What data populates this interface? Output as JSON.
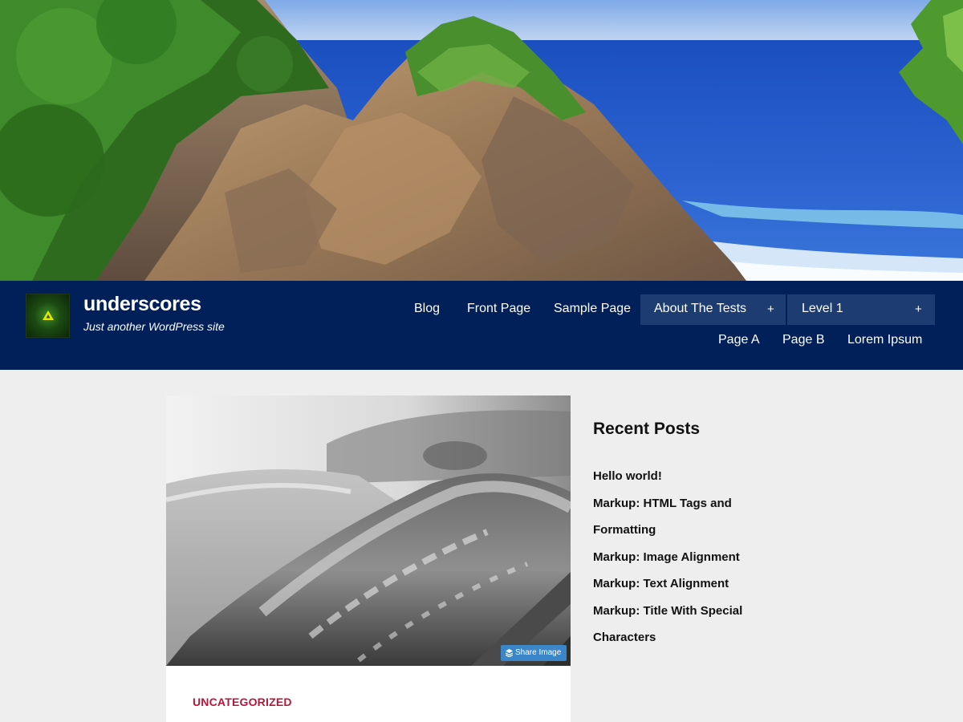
{
  "site": {
    "title": "underscores",
    "tagline": "Just another WordPress site",
    "logo_icon": "triangle-logo-icon"
  },
  "nav": {
    "primary": [
      {
        "label": "Blog"
      },
      {
        "label": "Front Page"
      },
      {
        "label": "Sample Page"
      },
      {
        "label": "About The Tests",
        "has_children": true,
        "active": true
      },
      {
        "label": "Level 1",
        "has_children": true
      }
    ],
    "secondary": [
      {
        "label": "Page A"
      },
      {
        "label": "Page B"
      },
      {
        "label": "Lorem Ipsum"
      }
    ],
    "expand_glyph": "+"
  },
  "post": {
    "share_label": "Share Image",
    "share_icon": "layers-icon",
    "category": "UNCATEGORIZED"
  },
  "sidebar": {
    "widget_title": "Recent Posts",
    "recent_posts": [
      "Hello world!",
      "Markup: HTML Tags and Formatting",
      "Markup: Image Alignment",
      "Markup: Text Alignment",
      "Markup: Title With Special Characters"
    ]
  },
  "colors": {
    "masthead": "#011f58",
    "nav_active": "#1c3c72",
    "category": "#b5173b",
    "share_button": "#3b86c9",
    "page_background": "#eeeeee"
  }
}
